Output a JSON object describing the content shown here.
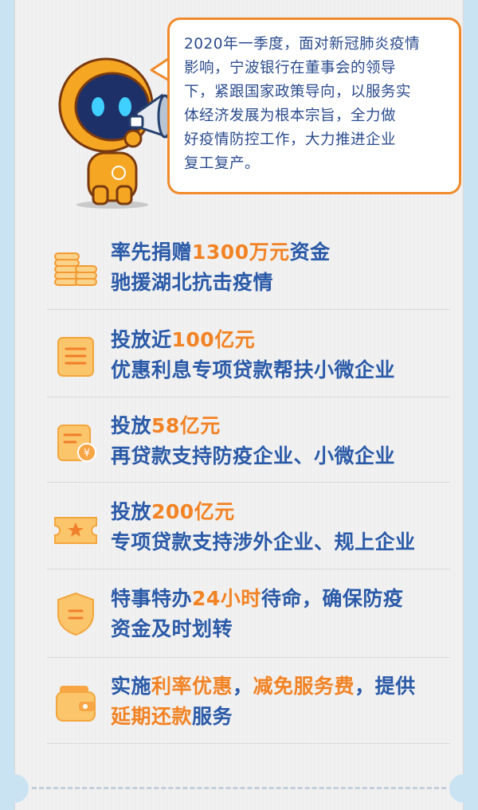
{
  "intro": {
    "lines": [
      "2020年一季度，面对新冠肺炎疫情",
      "影响，宁波银行在董事会的领导",
      "下，紧跟国家政策导向，以服务实",
      "体经济发展为根本宗旨，全力做",
      "好疫情防控工作，大力推进企业",
      "复工复产。"
    ]
  },
  "items": [
    {
      "icon": "coins-icon",
      "l1a": "率先捐赠",
      "l1b": "1300万元",
      "l1c": "资金",
      "l2": "驰援湖北抗击疫情"
    },
    {
      "icon": "document-icon",
      "l1a": "投放近",
      "l1b": "100亿元",
      "l2": "优惠利息专项贷款帮扶小微企业"
    },
    {
      "icon": "loan-card-icon",
      "l1a": "投放",
      "l1b": "58亿元",
      "l2": "再贷款支持防疫企业、小微企业"
    },
    {
      "icon": "ticket-icon",
      "l1a": "投放",
      "l1b": "200亿元",
      "l2": "专项贷款支持涉外企业、规上企业"
    },
    {
      "icon": "shield-icon",
      "l1a": "特事特办",
      "l1b": "24小时",
      "l1c": "待命，确保防疫",
      "l2": "资金及时划转"
    },
    {
      "icon": "wallet-icon",
      "l1a": "实施",
      "l1b": "利率优惠",
      "l1c": "，",
      "l1d": "减免服务费",
      "l1e": "，提供",
      "l2a": "延期还款",
      "l2b": "服务"
    }
  ],
  "colors": {
    "accent": "#f28324",
    "text": "#2a5aa8",
    "bg": "#c9e3f3"
  }
}
